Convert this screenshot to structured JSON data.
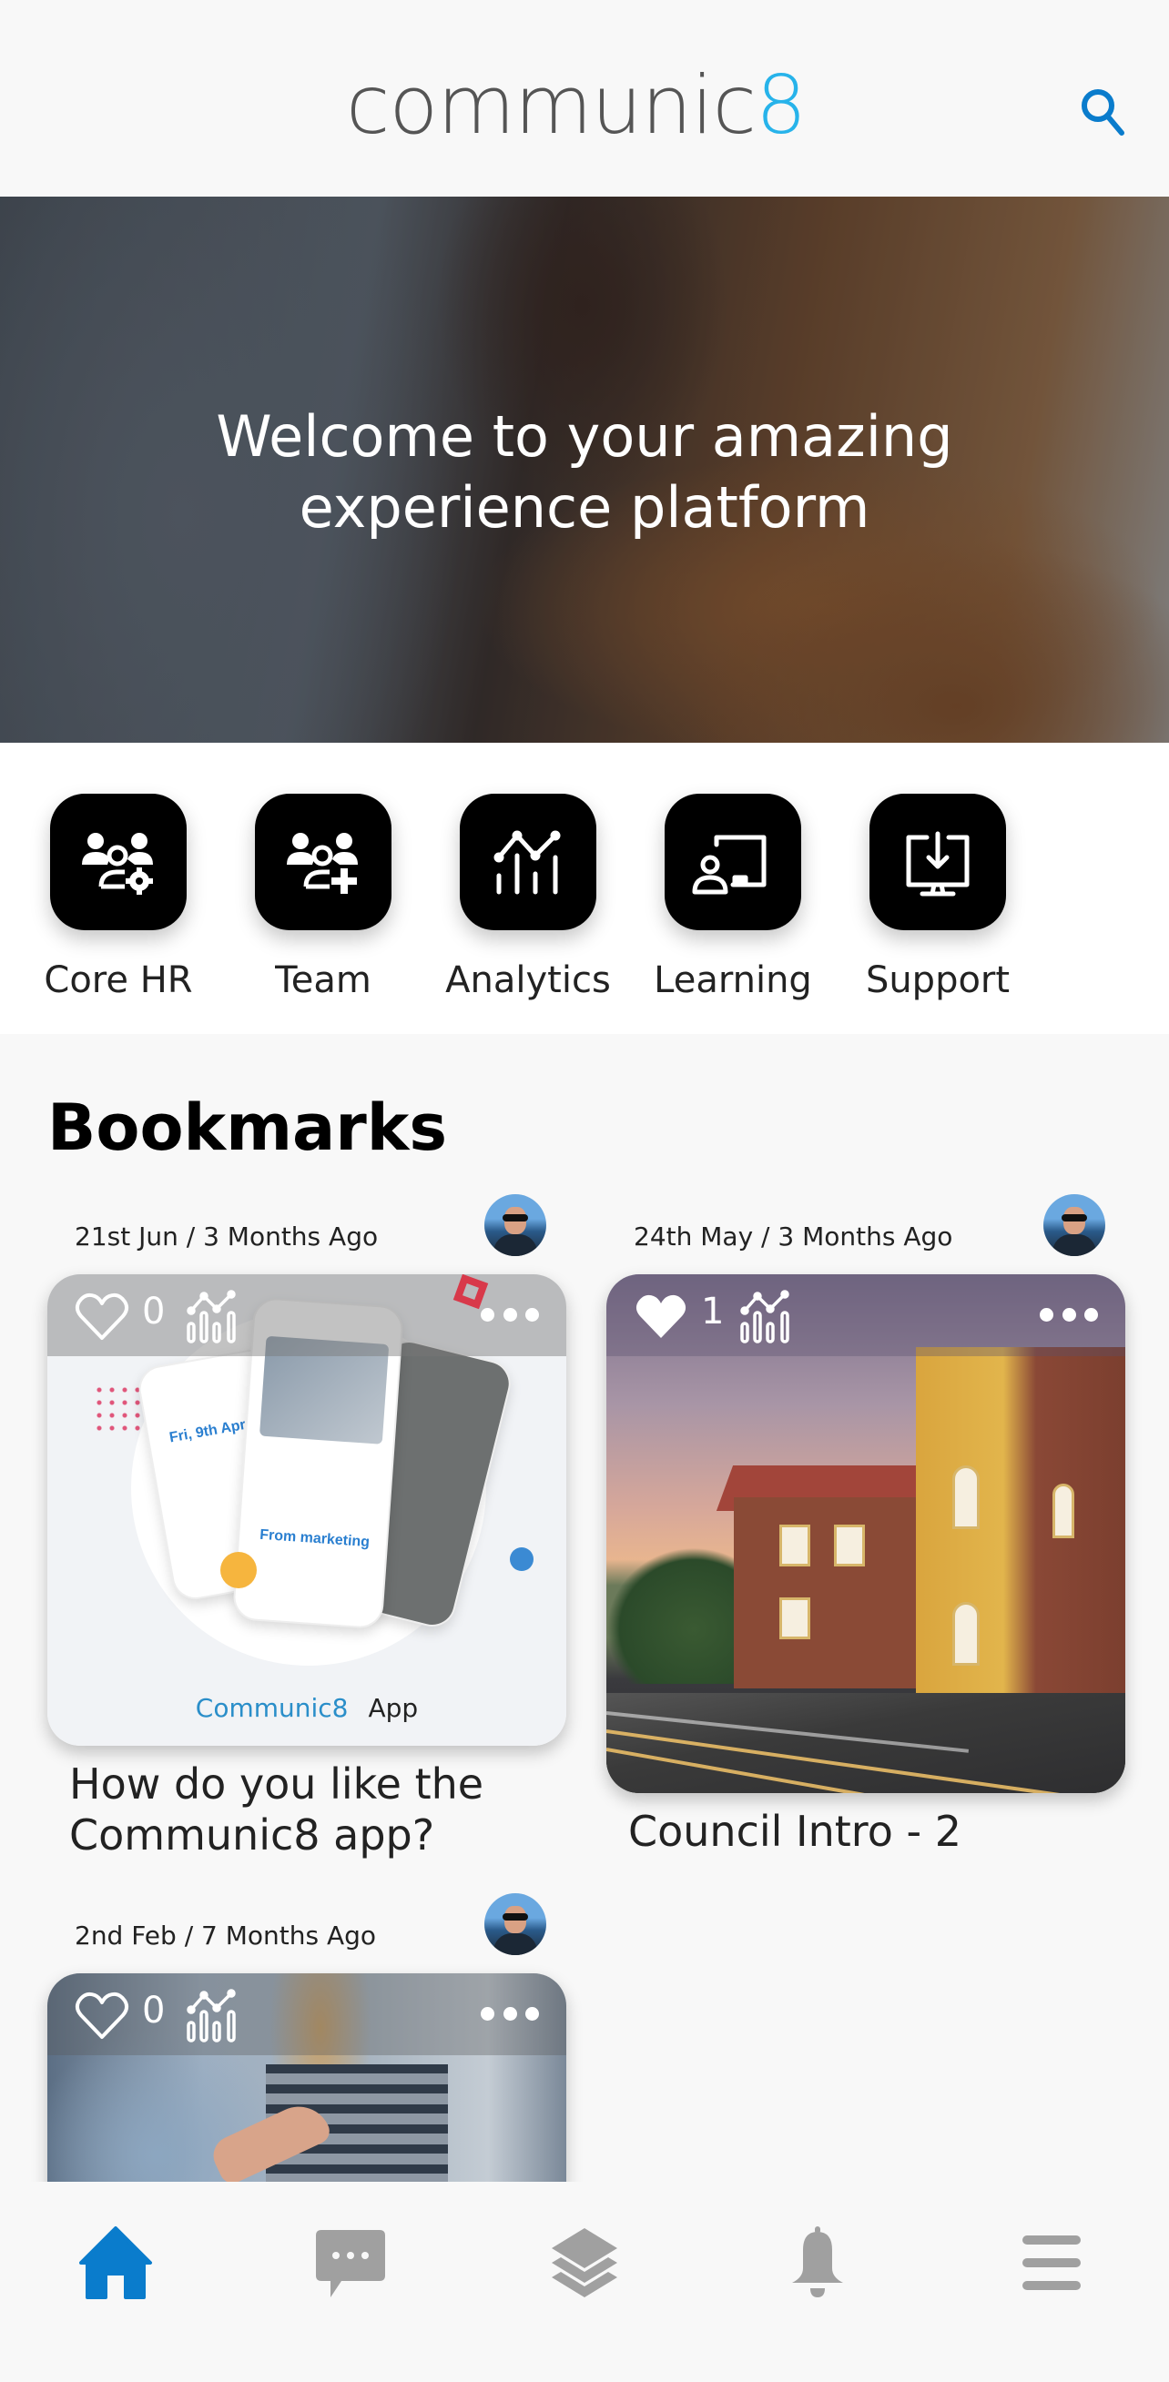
{
  "header": {
    "logo_text": "communic",
    "logo_accent": "8",
    "search_icon": "search-icon"
  },
  "hero": {
    "title_line1": "Welcome to your amazing",
    "title_line2": "experience platform"
  },
  "quick_links": [
    {
      "label": "Core HR",
      "icon": "users-gear-icon"
    },
    {
      "label": "Team",
      "icon": "users-plus-icon"
    },
    {
      "label": "Analytics",
      "icon": "analytics-chart-icon"
    },
    {
      "label": "Learning",
      "icon": "teacher-board-icon"
    },
    {
      "label": "Support",
      "icon": "monitor-download-icon"
    }
  ],
  "bookmarks": {
    "title": "Bookmarks",
    "posts": [
      {
        "meta": "21st Jun / 3 Months Ago",
        "likes": "0",
        "liked": false,
        "title_line1": "How do you like the",
        "title_line2": "Communic8 app?",
        "image": "communic8-app-promo",
        "image_brand": "Communic8",
        "image_brand_suffix": "App"
      },
      {
        "meta": "24th May / 3 Months Ago",
        "likes": "1",
        "liked": true,
        "title_line1": "Council Intro - 2",
        "image": "council-building"
      },
      {
        "meta": "2nd Feb / 7 Months Ago",
        "likes": "0",
        "liked": false,
        "image": "team-meeting"
      }
    ]
  },
  "bottom_nav": [
    {
      "name": "home",
      "icon": "home-icon",
      "active": true
    },
    {
      "name": "messages",
      "icon": "chat-icon",
      "active": false
    },
    {
      "name": "layers",
      "icon": "layers-icon",
      "active": false
    },
    {
      "name": "notifications",
      "icon": "bell-icon",
      "active": false
    },
    {
      "name": "menu",
      "icon": "hamburger-menu-icon",
      "active": false
    }
  ],
  "colors": {
    "brand_accent": "#27b3ea",
    "active_nav": "#0a7ccc",
    "inactive_nav": "#a0a0a0",
    "search_icon": "#0a7ccc"
  }
}
